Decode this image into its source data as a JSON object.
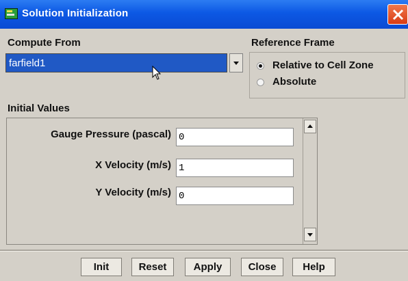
{
  "window": {
    "title": "Solution Initialization",
    "icons": {
      "app": "fluent-app-icon",
      "close": "close-icon"
    },
    "colors": {
      "titlebar": "#0c58e4",
      "close_button": "#d93c14",
      "selection": "#2059c5"
    }
  },
  "compute_from": {
    "label": "Compute From",
    "selected": "farfield1"
  },
  "reference_frame": {
    "label": "Reference Frame",
    "options": [
      {
        "label": "Relative to Cell Zone",
        "checked": true
      },
      {
        "label": "Absolute",
        "checked": false
      }
    ]
  },
  "initial_values": {
    "label": "Initial Values",
    "fields": [
      {
        "label": "Gauge Pressure (pascal)",
        "value": "0"
      },
      {
        "label": "X Velocity (m/s)",
        "value": "1"
      },
      {
        "label": "Y Velocity (m/s)",
        "value": "0"
      }
    ]
  },
  "buttons": {
    "init": "Init",
    "reset": "Reset",
    "apply": "Apply",
    "close": "Close",
    "help": "Help"
  }
}
